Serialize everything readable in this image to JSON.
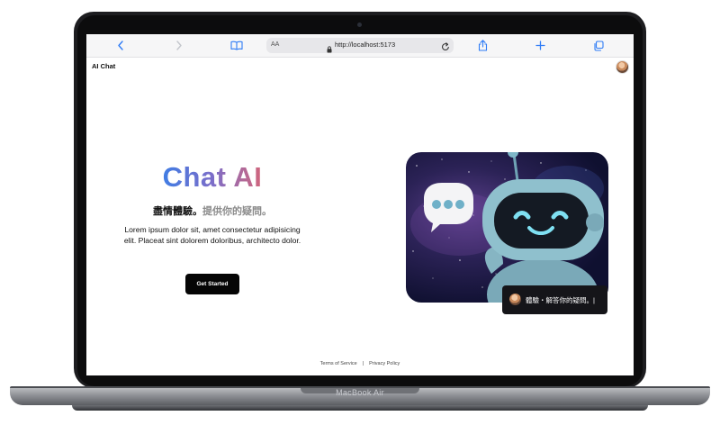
{
  "browser": {
    "url": "http://localhost:5173",
    "text_size_label": "AA",
    "icons": [
      "back-arrow-icon",
      "forward-arrow-icon",
      "book-icon",
      "lock-icon",
      "reload-icon",
      "share-icon",
      "plus-icon",
      "tabs-icon"
    ]
  },
  "app": {
    "title": "AI Chat"
  },
  "hero": {
    "title": "Chat AI",
    "subtitle_main": "盡情體驗。",
    "subtitle_muted": "提供你的疑問。",
    "body": "Lorem ipsum dolor sit, amet consectetur adipisicing elit. Placeat sint dolorem doloribus, architecto dolor.",
    "cta_label": "Get Started"
  },
  "chat_chip": {
    "text": "體驗・解答你的疑問。|"
  },
  "footer": {
    "links": [
      "Terms of Service",
      "Privacy Policy"
    ],
    "separator": "|"
  },
  "device": {
    "brand_label": "MacBook Air"
  },
  "colors": {
    "accent": "#2f7cf6",
    "title_gradient_start": "#3b7ee6",
    "title_gradient_end": "#d96575",
    "cta_background": "#050505"
  }
}
